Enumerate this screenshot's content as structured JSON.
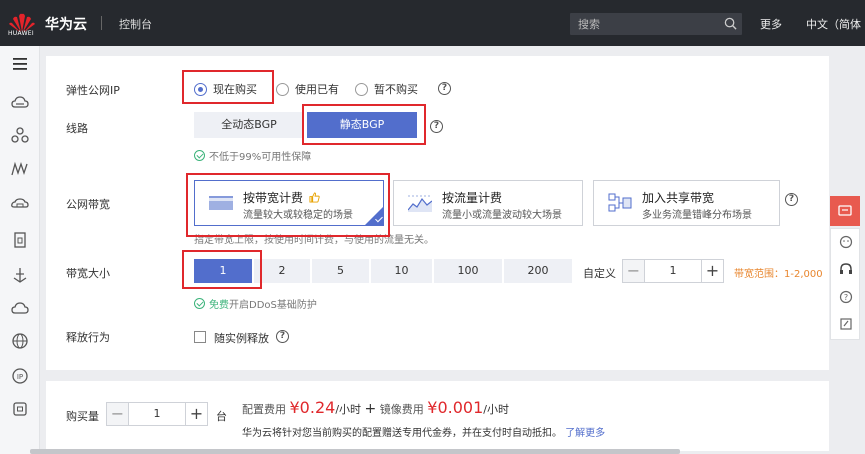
{
  "topbar": {
    "logo_text": "HUAWEI",
    "brand": "华为云",
    "console": "控制台",
    "search_placeholder": "搜索",
    "more": "更多",
    "lang": "中文（简体"
  },
  "eip": {
    "label": "弹性公网IP",
    "options": [
      "现在购买",
      "使用已有",
      "暂不购买"
    ],
    "selected": "现在购买"
  },
  "line": {
    "label": "线路",
    "options": [
      "全动态BGP",
      "静态BGP"
    ],
    "selected": "静态BGP",
    "note": "不低于99%可用性保障"
  },
  "billing": {
    "label": "公网带宽",
    "cards": [
      {
        "title": "按带宽计费",
        "desc": "流量较大或较稳定的场景"
      },
      {
        "title": "按流量计费",
        "desc": "流量小或流量波动较大场景"
      },
      {
        "title": "加入共享带宽",
        "desc": "多业务流量错峰分布场景"
      }
    ],
    "note": "指定带宽上限，按使用时间计费，与使用的流量无关。"
  },
  "bandwidth": {
    "label": "带宽大小",
    "sizes": [
      "1",
      "2",
      "5",
      "10",
      "100",
      "200"
    ],
    "selected": "1",
    "custom_label": "自定义",
    "custom_value": "1",
    "range": "带宽范围：1-2,000 M",
    "note_free": "免费",
    "note_rest": "开启DDoS基础防护"
  },
  "release": {
    "label": "释放行为",
    "checkbox_label": "随实例释放"
  },
  "footer": {
    "qty_label": "购买量",
    "qty_value": "1",
    "unit": "台",
    "config_fee_label": "配置费用",
    "config_fee": "¥0.24",
    "per_hour": "/小时",
    "plus": "+",
    "mirror_fee_label": "镜像费用",
    "mirror_fee": "¥0.001",
    "per_hour2": "/小时",
    "notice": "华为云将针对您当前购买的配置赠送专用代金券，并在支付时自动抵扣。",
    "learn_more": "了解更多"
  },
  "colors": {
    "topbar": "#26292e",
    "accent": "#526ecc",
    "highlight": "#e0282c",
    "price": "#e0282c",
    "range": "#e8862e",
    "ok": "#3bb37a"
  },
  "icons": {
    "sidebar": [
      "menu-icon",
      "cloud-server-icon",
      "network-icon",
      "mountain-icon",
      "database-icon",
      "storage-icon",
      "anchor-icon",
      "cloud-icon",
      "globe-icon",
      "ip-icon",
      "box-icon"
    ],
    "float": [
      "feedback-icon",
      "chat-icon",
      "headset-icon",
      "help-icon",
      "edit-icon"
    ]
  }
}
